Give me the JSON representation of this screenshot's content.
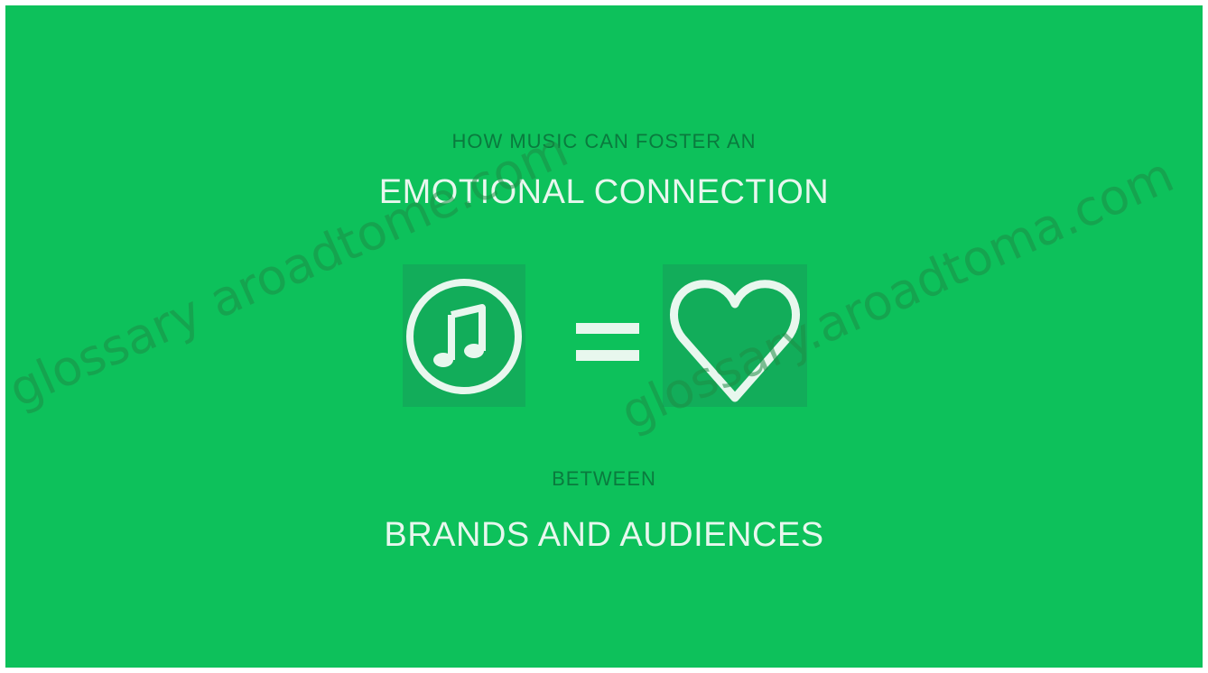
{
  "slide": {
    "kicker": "HOW MUSIC CAN FOSTER AN",
    "headline": "EMOTIONAL CONNECTION",
    "connector": "BETWEEN",
    "subline": "BRANDS AND AUDIENCES"
  },
  "icons": {
    "left": "music-note-icon",
    "middle": "equals-icon",
    "right": "heart-icon"
  },
  "watermark": {
    "text_1": "glossary aroadtome.com",
    "text_2": "glossary.aroadtoma.com"
  },
  "colors": {
    "background": "#0dc15b",
    "icon_backdrop": "#12ad5a",
    "light_text": "#e8f7ee",
    "dark_text": "#0a7a3e"
  }
}
